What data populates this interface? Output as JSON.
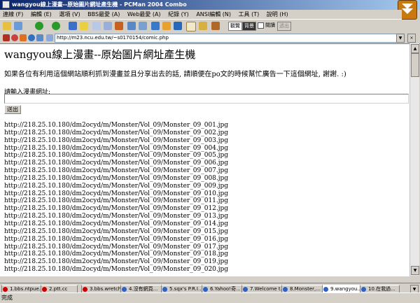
{
  "window": {
    "title": "wangyou線上漫畫--原始圖片網址產生機 - PCMan 2004 Combo"
  },
  "menu": [
    "連線 (F)",
    "編輯 (E)",
    "選項 (V)",
    "BBS最愛 (A)",
    "Web最愛 (A)",
    "紀錄 (Y)",
    "ANSI編輯 (N)",
    "工具 (T)",
    "說明 (H)"
  ],
  "toolbar": {
    "mode_1": "觀覽",
    "mode_2": "背景",
    "mode_3": "閱讀",
    "mode_4": "透出"
  },
  "address": {
    "url": "http://m23.ncu.edu.tw/~s0170154/comic.php"
  },
  "page": {
    "title": "wangyou線上漫畫--原始圖片網址產生機",
    "intro": "如果各位有利用這個網站順利抓到漫畫並且分享出去的話, 請順便在po文的時候幫忙廣告一下這個網址, 謝謝. :)",
    "prompt": "請輸入漫畫網址:",
    "submit_label": "送出",
    "urls": [
      "http://218.25.10.180/dm2ocyd/m/Monster/Vol_09/Monster_09_001.jpg",
      "http://218.25.10.180/dm2ocyd/m/Monster/Vol_09/Monster_09_002.jpg",
      "http://218.25.10.180/dm2ocyd/m/Monster/Vol_09/Monster_09_003.jpg",
      "http://218.25.10.180/dm2ocyd/m/Monster/Vol_09/Monster_09_004.jpg",
      "http://218.25.10.180/dm2ocyd/m/Monster/Vol_09/Monster_09_005.jpg",
      "http://218.25.10.180/dm2ocyd/m/Monster/Vol_09/Monster_09_006.jpg",
      "http://218.25.10.180/dm2ocyd/m/Monster/Vol_09/Monster_09_007.jpg",
      "http://218.25.10.180/dm2ocyd/m/Monster/Vol_09/Monster_09_008.jpg",
      "http://218.25.10.180/dm2ocyd/m/Monster/Vol_09/Monster_09_009.jpg",
      "http://218.25.10.180/dm2ocyd/m/Monster/Vol_09/Monster_09_010.jpg",
      "http://218.25.10.180/dm2ocyd/m/Monster/Vol_09/Monster_09_011.jpg",
      "http://218.25.10.180/dm2ocyd/m/Monster/Vol_09/Monster_09_012.jpg",
      "http://218.25.10.180/dm2ocyd/m/Monster/Vol_09/Monster_09_013.jpg",
      "http://218.25.10.180/dm2ocyd/m/Monster/Vol_09/Monster_09_014.jpg",
      "http://218.25.10.180/dm2ocyd/m/Monster/Vol_09/Monster_09_015.jpg",
      "http://218.25.10.180/dm2ocyd/m/Monster/Vol_09/Monster_09_016.jpg",
      "http://218.25.10.180/dm2ocyd/m/Monster/Vol_09/Monster_09_017.jpg",
      "http://218.25.10.180/dm2ocyd/m/Monster/Vol_09/Monster_09_018.jpg",
      "http://218.25.10.180/dm2ocyd/m/Monster/Vol_09/Monster_09_019.jpg",
      "http://218.25.10.180/dm2ocyd/m/Monster/Vol_09/Monster_09_020.jpg"
    ]
  },
  "tabs": [
    {
      "label": "1.bbs.ntpue...",
      "active": false
    },
    {
      "label": "2.ptt.cc",
      "active": false
    },
    {
      "label": "3.bbs.wretch...",
      "active": false
    },
    {
      "label": "4.沒有網頁...",
      "active": false
    },
    {
      "label": "5.sqx's P.R.I...",
      "active": false
    },
    {
      "label": "6.Yahoo!奇...",
      "active": false
    },
    {
      "label": "7.Welcome t...",
      "active": false
    },
    {
      "label": "8.Monster,...",
      "active": false
    },
    {
      "label": "9.wangyou...",
      "active": true
    },
    {
      "label": "10.在我過...",
      "active": false
    }
  ],
  "status": {
    "text": "完成"
  }
}
